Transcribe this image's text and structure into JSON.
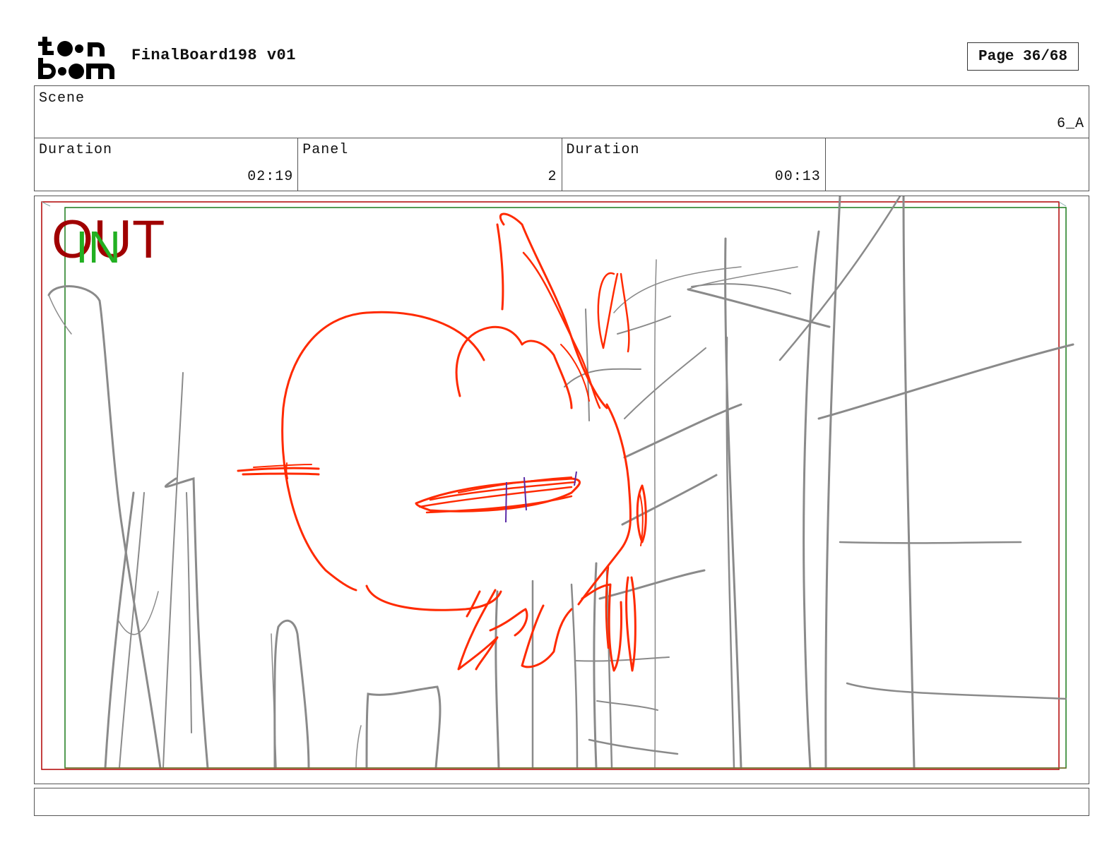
{
  "header": {
    "logo_text": "toon boom",
    "title": "FinalBoard198 v01",
    "page_label": "Page 36/68"
  },
  "scene": {
    "label": "Scene",
    "value": "6_A"
  },
  "info": [
    {
      "label": "Duration",
      "value": "02:19"
    },
    {
      "label": "Panel",
      "value": "2"
    },
    {
      "label": "Duration",
      "value": "00:13"
    },
    {
      "label": "",
      "value": ""
    }
  ],
  "panel": {
    "out_label": "OUT",
    "in_label": "IN",
    "colors": {
      "sketch_foreground": "#ff2a00",
      "sketch_background": "#8a8a8a",
      "frame_out": "#b00000",
      "frame_in": "#1a7a1a",
      "accent_stroke": "#5a2aa8"
    }
  },
  "notes": {
    "text": ""
  }
}
